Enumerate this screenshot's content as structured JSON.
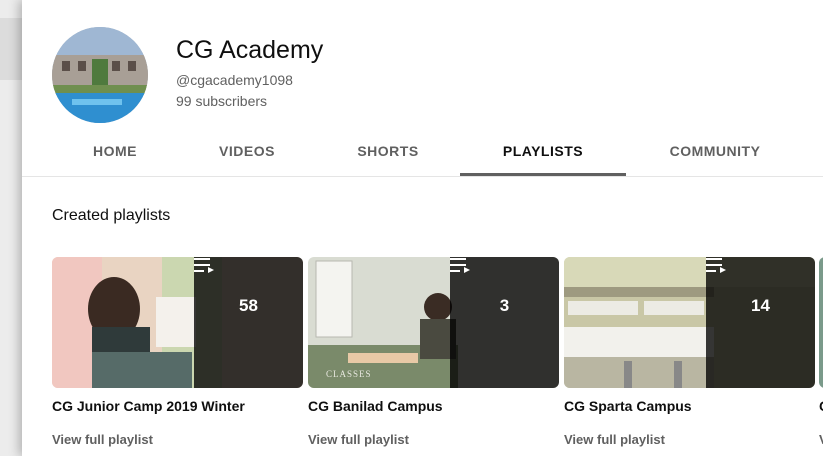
{
  "channel": {
    "name": "CG Academy",
    "handle": "@cgacademy1098",
    "subscribers": "99 subscribers"
  },
  "tabs": [
    {
      "label": "HOME"
    },
    {
      "label": "VIDEOS"
    },
    {
      "label": "SHORTS"
    },
    {
      "label": "PLAYLISTS",
      "active": true
    },
    {
      "label": "COMMUNITY"
    }
  ],
  "section_title": "Created playlists",
  "playlists": [
    {
      "title": "CG Junior Camp 2019 Winter",
      "count": "58",
      "link": "View full playlist"
    },
    {
      "title": "CG Banilad Campus",
      "count": "3",
      "link": "View full playlist",
      "thumb_text": "CLASSES"
    },
    {
      "title": "CG Sparta Campus",
      "count": "14",
      "link": "View full playlist"
    }
  ],
  "peek": {
    "title": "C",
    "link": "V"
  },
  "icons": {
    "playlist": "playlist-play-icon"
  }
}
